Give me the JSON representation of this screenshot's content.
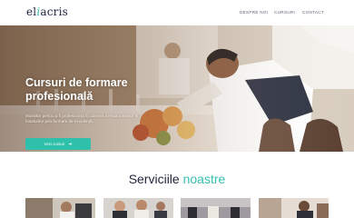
{
  "header": {
    "logo_main": "el",
    "logo_accent": "i",
    "logo_rest": "acris",
    "nav": [
      "DESPRE NOI",
      "CURSURI",
      "CONTACT"
    ]
  },
  "hero": {
    "title": "Cursuri de formare profesională",
    "description": "Motivăm pentru a fi profesioniști în domeniul restaurantelor și hotelurilor prin formare de excelență.",
    "button_label": "Vezi cursuri",
    "button_icon": "arrow-right-icon"
  },
  "services": {
    "title_main": "Serviciile",
    "title_accent": "noastre"
  },
  "colors": {
    "accent": "#2ec0ab",
    "dark": "#1c2340"
  }
}
